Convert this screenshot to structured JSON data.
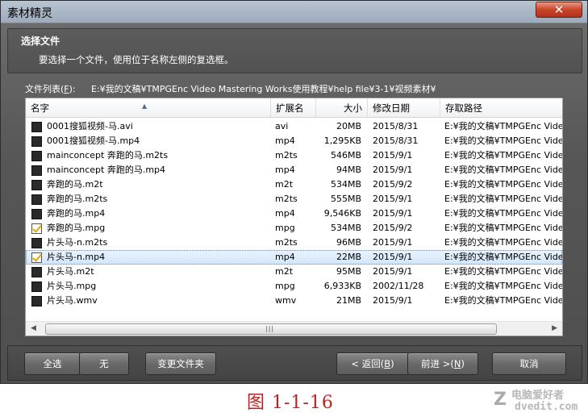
{
  "window": {
    "title": "素材精灵",
    "close_symbol": "✕"
  },
  "header": {
    "title": "选择文件",
    "description": "要选择一个文件，使用位于名称左侧的复选框。"
  },
  "file_list": {
    "label_prefix": "文件列表(",
    "label_key": "F",
    "label_suffix": "):",
    "path": "E:¥我的文稿¥TMPGEnc Video Mastering Works使用教程¥help file¥3-1¥视频素材¥"
  },
  "columns": {
    "name": "名字",
    "ext": "扩展名",
    "size": "大小",
    "date": "修改日期",
    "path": "存取路径"
  },
  "rows": [
    {
      "name": "0001搜狐视频-马.avi",
      "ext": "avi",
      "size": "20MB",
      "date": "2015/8/31",
      "path": "E:¥我的文稿¥TMPGEnc Video",
      "checked": false,
      "selected": false
    },
    {
      "name": "0001搜狐视频-马.mp4",
      "ext": "mp4",
      "size": "1,295KB",
      "date": "2015/8/31",
      "path": "E:¥我的文稿¥TMPGEnc Video",
      "checked": false,
      "selected": false
    },
    {
      "name": "mainconcept 奔跑的马.m2ts",
      "ext": "m2ts",
      "size": "546MB",
      "date": "2015/9/1",
      "path": "E:¥我的文稿¥TMPGEnc Video",
      "checked": false,
      "selected": false
    },
    {
      "name": "mainconcept 奔跑的马.mp4",
      "ext": "mp4",
      "size": "94MB",
      "date": "2015/9/1",
      "path": "E:¥我的文稿¥TMPGEnc Video",
      "checked": false,
      "selected": false
    },
    {
      "name": "奔跑的马.m2t",
      "ext": "m2t",
      "size": "534MB",
      "date": "2015/9/2",
      "path": "E:¥我的文稿¥TMPGEnc Video",
      "checked": false,
      "selected": false
    },
    {
      "name": "奔跑的马.m2ts",
      "ext": "m2ts",
      "size": "555MB",
      "date": "2015/9/1",
      "path": "E:¥我的文稿¥TMPGEnc Video",
      "checked": false,
      "selected": false
    },
    {
      "name": "奔跑的马.mp4",
      "ext": "mp4",
      "size": "9,546KB",
      "date": "2015/9/1",
      "path": "E:¥我的文稿¥TMPGEnc Video",
      "checked": false,
      "selected": false
    },
    {
      "name": "奔跑的马.mpg",
      "ext": "mpg",
      "size": "534MB",
      "date": "2015/9/2",
      "path": "E:¥我的文稿¥TMPGEnc Video",
      "checked": true,
      "selected": false
    },
    {
      "name": "片头马-n.m2ts",
      "ext": "m2ts",
      "size": "96MB",
      "date": "2015/9/1",
      "path": "E:¥我的文稿¥TMPGEnc Video",
      "checked": false,
      "selected": false
    },
    {
      "name": "片头马-n.mp4",
      "ext": "mp4",
      "size": "22MB",
      "date": "2015/9/1",
      "path": "E:¥我的文稿¥TMPGEnc Video",
      "checked": true,
      "selected": true
    },
    {
      "name": "片头马.m2t",
      "ext": "m2t",
      "size": "95MB",
      "date": "2015/9/1",
      "path": "E:¥我的文稿¥TMPGEnc Video",
      "checked": false,
      "selected": false
    },
    {
      "name": "片头马.mpg",
      "ext": "mpg",
      "size": "6,933KB",
      "date": "2002/11/28",
      "path": "E:¥我的文稿¥TMPGEnc Video",
      "checked": false,
      "selected": false
    },
    {
      "name": "片头马.wmv",
      "ext": "wmv",
      "size": "21MB",
      "date": "2015/9/1",
      "path": "E:¥我的文稿¥TMPGEnc Video",
      "checked": false,
      "selected": false
    }
  ],
  "scrollbar": {
    "left_arrow": "◀",
    "right_arrow": "▶",
    "grip": "|||"
  },
  "buttons": {
    "select_all": "全选",
    "none": "无",
    "change_folder": "变更文件夹",
    "back_prefix": "< 返回(",
    "back_key": "B",
    "back_suffix": ")",
    "next_prefix": "前进 >(",
    "next_key": "N",
    "next_suffix": ")",
    "cancel": "取消"
  },
  "caption": "图 1-1-16",
  "watermark": {
    "line1": "电脑爱好者",
    "line2": "dvedit.com"
  }
}
